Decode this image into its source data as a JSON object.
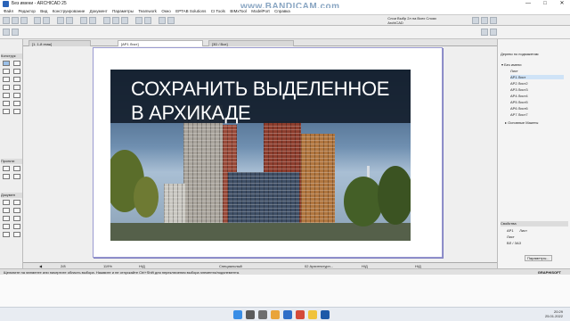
{
  "window": {
    "title": "Без имени - ARCHICAD 25",
    "controls": [
      "—",
      "□",
      "✕"
    ]
  },
  "recording": {
    "watermark": "www.BANDICAM.com"
  },
  "menu": [
    "Файл",
    "Редактор",
    "Вид",
    "Конструирование",
    "Документ",
    "Параметры",
    "Teamwork",
    "Окно",
    "ЕРТАВ Solutions",
    "CI Tools",
    "BIMxTool",
    "ModelPort",
    "Справка"
  ],
  "toolbar": {
    "layer_line1": "Слои Выбр 2л на Всех Слоях",
    "layer_line2": "ArchiCAD"
  },
  "tabs": [
    {
      "label": "[1. 1-й этаж]"
    },
    {
      "label": "[АР1 Лист]"
    },
    {
      "label": "[3D / Все]"
    }
  ],
  "left_panel": {
    "section_design": "Конструк",
    "section_document": "Проекти",
    "section_doc2": "Докумен"
  },
  "drawing": {
    "headline_line1": "СОХРАНИТЬ ВЫДЕЛЕННОЕ",
    "headline_line2": "В АРХИКАДЕ"
  },
  "navigator": {
    "title": "Дерево по подмакетам",
    "root": "Без имени",
    "items": [
      "Лист",
      "АР1 Лист",
      "АР2 Лист2",
      "АР3 Лист3",
      "АР4 Лист4",
      "АР5 Лист5",
      "АР6 Лист6",
      "АР7 Лист7"
    ],
    "master": "Основные Макеты",
    "selected_index": 1
  },
  "properties": {
    "header": "Свойства",
    "row1_key": "АР1",
    "row1_val": "Лист",
    "row2": "Лист",
    "row3": "ВЛ / ЗАЗ",
    "settings_button": "Параметры..."
  },
  "statusbar": {
    "page": "2/8",
    "zoom": "119%",
    "mode": "Специальный",
    "layer": "02 Архитектурн...",
    "na": "Н/Д"
  },
  "hint": "Щелкните на элементе или начертите область выбора. Нажмите и не отпускайте Ctrl+Shift для переключения выбора элемента/подэлемента.",
  "brand": "GRAPHISOFT",
  "clock": {
    "time": "20:29",
    "date": "25.01.2022"
  }
}
